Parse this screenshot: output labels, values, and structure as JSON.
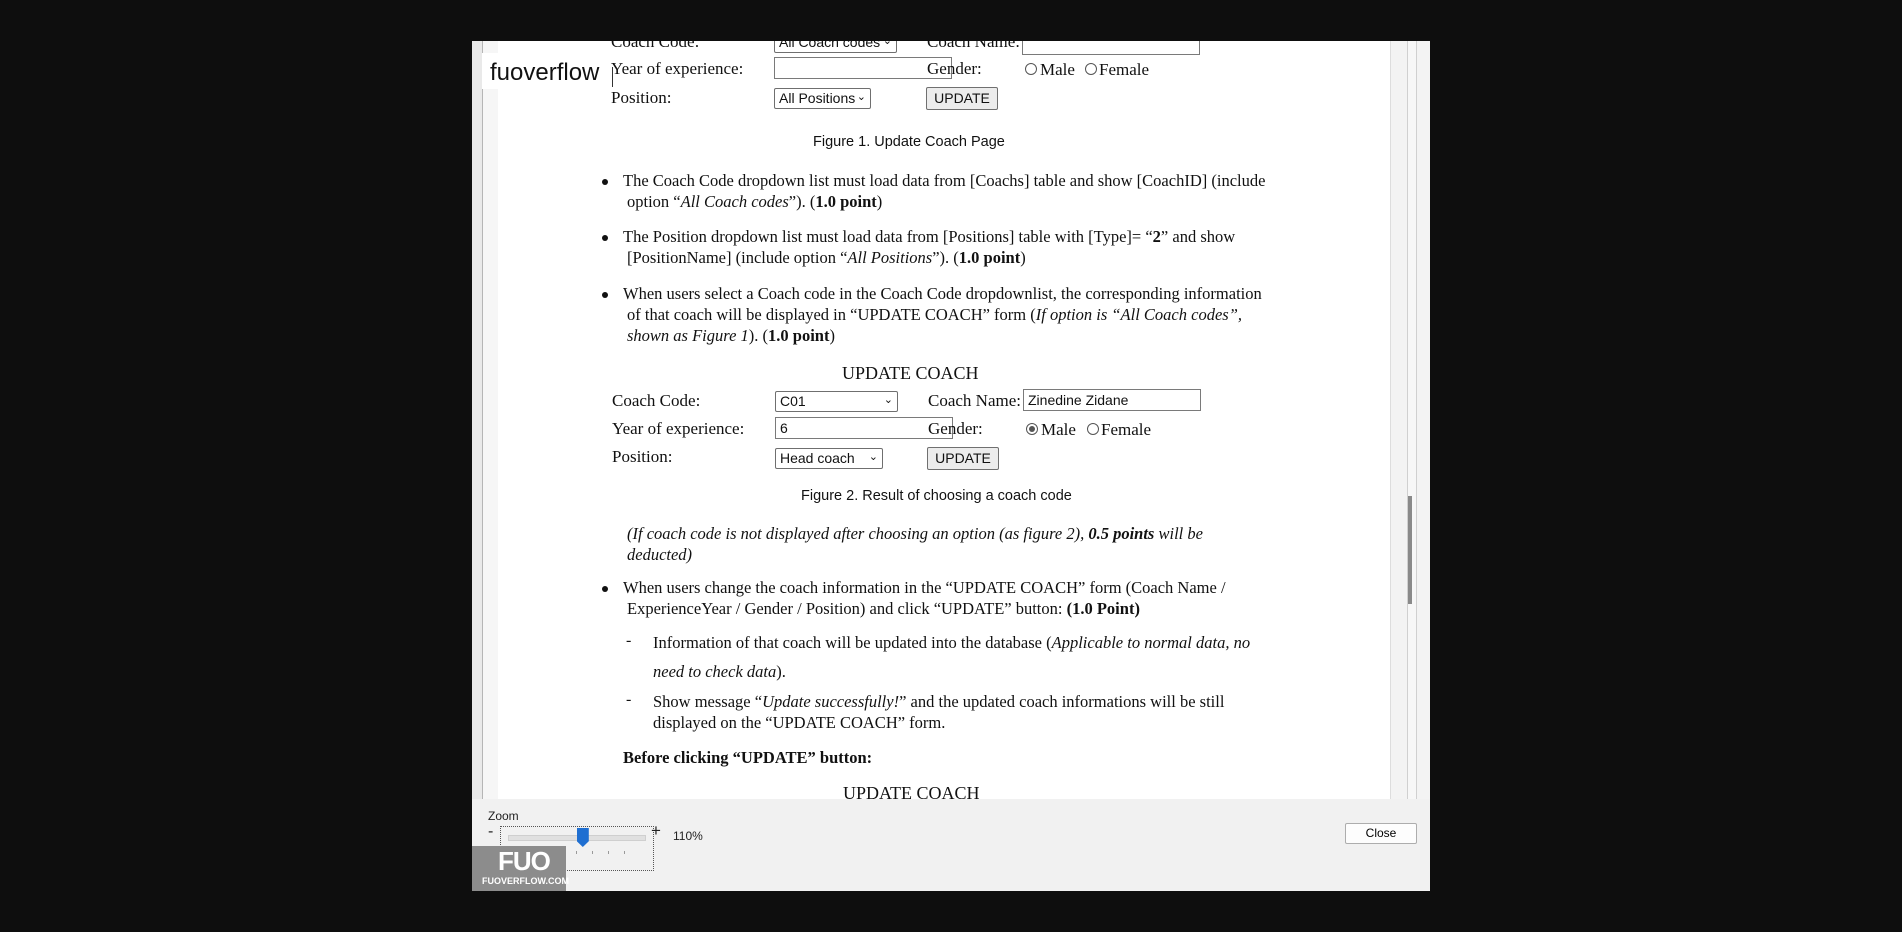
{
  "app": {
    "logo_text": "fuoverflow",
    "watermark_mark": "FUO",
    "watermark_text": "FUOVERFLOW.COM",
    "accent": "#1f6fd1"
  },
  "form1": {
    "coach_code_label": "Coach Code:",
    "coach_code_value": "All Coach codes",
    "coach_name_label": "Coach Name:",
    "coach_name_value": "",
    "year_label": "Year of experience:",
    "year_value": "",
    "gender_label": "Gender:",
    "male_label": "Male",
    "female_label": "Female",
    "position_label": "Position:",
    "position_value": "All Positions",
    "update_label": "UPDATE"
  },
  "figure1_caption": "Figure 1. Update Coach Page",
  "bullets": {
    "b1_l1": "The Coach Code dropdown list must load data from [Coachs] table and show [CoachID] (include",
    "b1_l2a": "option “",
    "b1_l2b": "All Coach codes",
    "b1_l2c": "”). (",
    "b1_l2d": "1.0 point",
    "b1_l2e": ")",
    "b2_l1a": "The Position dropdown list must load data from [Positions] table with [Type]= “",
    "b2_l1b": "2",
    "b2_l1c": "” and show",
    "b2_l2a": "[PositionName] (include option “",
    "b2_l2b": "All Positions",
    "b2_l2c": "”). (",
    "b2_l2d": "1.0 point",
    "b2_l2e": ")",
    "b3_l1": "When users select a Coach code in the Coach Code dropdownlist, the corresponding information",
    "b3_l2a": "of that coach will be displayed in “UPDATE COACH” form (",
    "b3_l2b": "If option is “All Coach codes”,",
    "b3_l3a": "shown as Figure 1",
    "b3_l3b": "). (",
    "b3_l3c": "1.0 point",
    "b3_l3d": ")"
  },
  "form2": {
    "title": "UPDATE COACH",
    "coach_code_label": "Coach Code:",
    "coach_code_value": "C01",
    "coach_name_label": "Coach Name:",
    "coach_name_value": "Zinedine Zidane",
    "year_label": "Year of experience:",
    "year_value": "6",
    "gender_label": "Gender:",
    "male_label": "Male",
    "female_label": "Female",
    "position_label": "Position:",
    "position_value": "Head coach",
    "update_label": "UPDATE"
  },
  "figure2_caption": "Figure 2. Result of choosing a coach code",
  "note": {
    "l1a": "(If coach code is not displayed after choosing an option (as figure 2),",
    "l1b": "0.5 points",
    "l1c": "will be",
    "l2": "deducted)"
  },
  "bullet4": {
    "l1": "When users change the coach information in the “UPDATE COACH” form (Coach Name /",
    "l2a": "ExperienceYear / Gender / Position) and click “UPDATE”  button: ",
    "l2b": "(1.0 Point)",
    "d1_l1a": "Information of that coach will be updated into the database (",
    "d1_l1b": "Applicable to normal data, no",
    "d1_l2a": "need to check data",
    "d1_l2b": ").",
    "d2_l1a": "Show message “",
    "d2_l1b": "Update successfully!",
    "d2_l1c": "” and the updated coach informations will be still",
    "d2_l2": "displayed on the “UPDATE COACH” form."
  },
  "before_heading": "Before clicking “UPDATE” button:",
  "form3_title": "UPDATE COACH",
  "bottom": {
    "zoom_label": "Zoom",
    "zoom_minus": "-",
    "zoom_plus": "+",
    "zoom_value": "110%",
    "zoom_position": 0.55,
    "close_label": "Close"
  }
}
